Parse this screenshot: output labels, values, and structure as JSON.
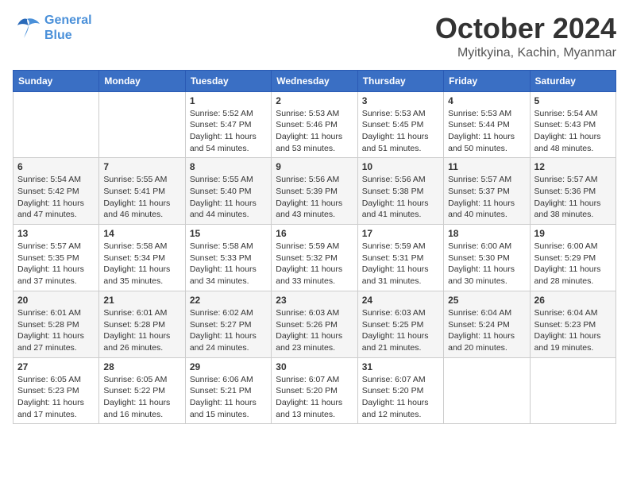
{
  "logo": {
    "line1": "General",
    "line2": "Blue"
  },
  "header": {
    "month": "October 2024",
    "location": "Myitkyina, Kachin, Myanmar"
  },
  "weekdays": [
    "Sunday",
    "Monday",
    "Tuesday",
    "Wednesday",
    "Thursday",
    "Friday",
    "Saturday"
  ],
  "weeks": [
    [
      {
        "day": "",
        "info": ""
      },
      {
        "day": "",
        "info": ""
      },
      {
        "day": "1",
        "info": "Sunrise: 5:52 AM\nSunset: 5:47 PM\nDaylight: 11 hours\nand 54 minutes."
      },
      {
        "day": "2",
        "info": "Sunrise: 5:53 AM\nSunset: 5:46 PM\nDaylight: 11 hours\nand 53 minutes."
      },
      {
        "day": "3",
        "info": "Sunrise: 5:53 AM\nSunset: 5:45 PM\nDaylight: 11 hours\nand 51 minutes."
      },
      {
        "day": "4",
        "info": "Sunrise: 5:53 AM\nSunset: 5:44 PM\nDaylight: 11 hours\nand 50 minutes."
      },
      {
        "day": "5",
        "info": "Sunrise: 5:54 AM\nSunset: 5:43 PM\nDaylight: 11 hours\nand 48 minutes."
      }
    ],
    [
      {
        "day": "6",
        "info": "Sunrise: 5:54 AM\nSunset: 5:42 PM\nDaylight: 11 hours\nand 47 minutes."
      },
      {
        "day": "7",
        "info": "Sunrise: 5:55 AM\nSunset: 5:41 PM\nDaylight: 11 hours\nand 46 minutes."
      },
      {
        "day": "8",
        "info": "Sunrise: 5:55 AM\nSunset: 5:40 PM\nDaylight: 11 hours\nand 44 minutes."
      },
      {
        "day": "9",
        "info": "Sunrise: 5:56 AM\nSunset: 5:39 PM\nDaylight: 11 hours\nand 43 minutes."
      },
      {
        "day": "10",
        "info": "Sunrise: 5:56 AM\nSunset: 5:38 PM\nDaylight: 11 hours\nand 41 minutes."
      },
      {
        "day": "11",
        "info": "Sunrise: 5:57 AM\nSunset: 5:37 PM\nDaylight: 11 hours\nand 40 minutes."
      },
      {
        "day": "12",
        "info": "Sunrise: 5:57 AM\nSunset: 5:36 PM\nDaylight: 11 hours\nand 38 minutes."
      }
    ],
    [
      {
        "day": "13",
        "info": "Sunrise: 5:57 AM\nSunset: 5:35 PM\nDaylight: 11 hours\nand 37 minutes."
      },
      {
        "day": "14",
        "info": "Sunrise: 5:58 AM\nSunset: 5:34 PM\nDaylight: 11 hours\nand 35 minutes."
      },
      {
        "day": "15",
        "info": "Sunrise: 5:58 AM\nSunset: 5:33 PM\nDaylight: 11 hours\nand 34 minutes."
      },
      {
        "day": "16",
        "info": "Sunrise: 5:59 AM\nSunset: 5:32 PM\nDaylight: 11 hours\nand 33 minutes."
      },
      {
        "day": "17",
        "info": "Sunrise: 5:59 AM\nSunset: 5:31 PM\nDaylight: 11 hours\nand 31 minutes."
      },
      {
        "day": "18",
        "info": "Sunrise: 6:00 AM\nSunset: 5:30 PM\nDaylight: 11 hours\nand 30 minutes."
      },
      {
        "day": "19",
        "info": "Sunrise: 6:00 AM\nSunset: 5:29 PM\nDaylight: 11 hours\nand 28 minutes."
      }
    ],
    [
      {
        "day": "20",
        "info": "Sunrise: 6:01 AM\nSunset: 5:28 PM\nDaylight: 11 hours\nand 27 minutes."
      },
      {
        "day": "21",
        "info": "Sunrise: 6:01 AM\nSunset: 5:28 PM\nDaylight: 11 hours\nand 26 minutes."
      },
      {
        "day": "22",
        "info": "Sunrise: 6:02 AM\nSunset: 5:27 PM\nDaylight: 11 hours\nand 24 minutes."
      },
      {
        "day": "23",
        "info": "Sunrise: 6:03 AM\nSunset: 5:26 PM\nDaylight: 11 hours\nand 23 minutes."
      },
      {
        "day": "24",
        "info": "Sunrise: 6:03 AM\nSunset: 5:25 PM\nDaylight: 11 hours\nand 21 minutes."
      },
      {
        "day": "25",
        "info": "Sunrise: 6:04 AM\nSunset: 5:24 PM\nDaylight: 11 hours\nand 20 minutes."
      },
      {
        "day": "26",
        "info": "Sunrise: 6:04 AM\nSunset: 5:23 PM\nDaylight: 11 hours\nand 19 minutes."
      }
    ],
    [
      {
        "day": "27",
        "info": "Sunrise: 6:05 AM\nSunset: 5:23 PM\nDaylight: 11 hours\nand 17 minutes."
      },
      {
        "day": "28",
        "info": "Sunrise: 6:05 AM\nSunset: 5:22 PM\nDaylight: 11 hours\nand 16 minutes."
      },
      {
        "day": "29",
        "info": "Sunrise: 6:06 AM\nSunset: 5:21 PM\nDaylight: 11 hours\nand 15 minutes."
      },
      {
        "day": "30",
        "info": "Sunrise: 6:07 AM\nSunset: 5:20 PM\nDaylight: 11 hours\nand 13 minutes."
      },
      {
        "day": "31",
        "info": "Sunrise: 6:07 AM\nSunset: 5:20 PM\nDaylight: 11 hours\nand 12 minutes."
      },
      {
        "day": "",
        "info": ""
      },
      {
        "day": "",
        "info": ""
      }
    ]
  ]
}
